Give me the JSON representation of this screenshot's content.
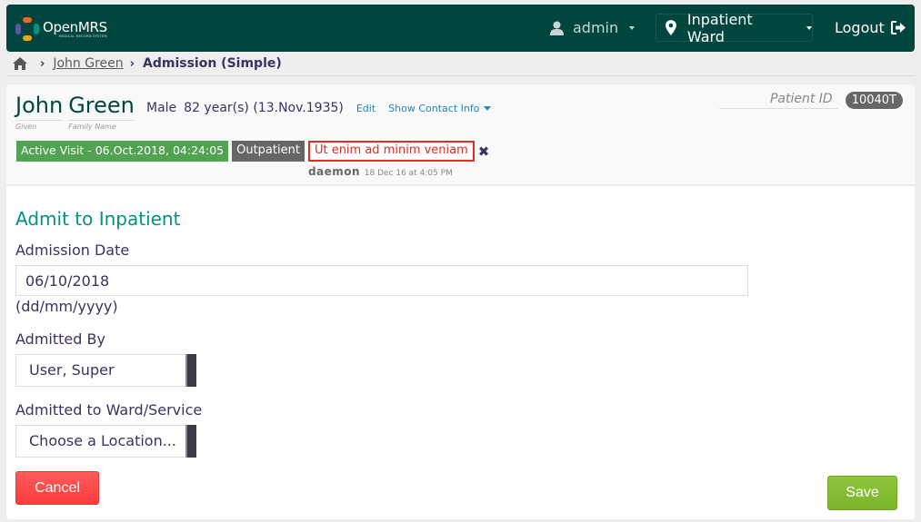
{
  "header": {
    "logo_name": "OpenMRS",
    "logo_subtitle": "MEDICAL RECORD SYSTEM",
    "user_label": "admin",
    "location_label": "Inpatient Ward",
    "logout_label": "Logout"
  },
  "breadcrumb": {
    "home_icon": "home-icon",
    "items": [
      {
        "label": "John Green"
      },
      {
        "label": "Admission (Simple)"
      }
    ]
  },
  "patient": {
    "given_name": "John",
    "family_name": "Green",
    "given_label": "Given",
    "family_label": "Family Name",
    "gender": "Male",
    "age_dob": "82 year(s) (13.Nov.1935)",
    "edit_label": "Edit",
    "contact_label": "Show Contact Info",
    "id_label": "Patient ID",
    "id_value": "10040T",
    "active_visit": "Active Visit - 06.Oct.2018, 04:24:05",
    "visit_type": "Outpatient",
    "flag_text": "Ut enim ad minim veniam",
    "flag_user": "daemon",
    "flag_time": "18 Dec 16 at 4:05 PM"
  },
  "form": {
    "title": "Admit to Inpatient",
    "admission_date_label": "Admission Date",
    "admission_date_value": "06/10/2018",
    "date_format_hint": "(dd/mm/yyyy)",
    "admitted_by_label": "Admitted By",
    "admitted_by_value": "User, Super",
    "ward_label": "Admitted to Ward/Service",
    "ward_value": "Choose a Location...",
    "cancel_label": "Cancel",
    "save_label": "Save"
  },
  "colors": {
    "header_bg": "#00463f",
    "accent_teal": "#009384",
    "visit_green": "#51a351",
    "flag_red": "#e02b27",
    "cancel_red": "#ff4444",
    "save_green": "#88c03a"
  }
}
